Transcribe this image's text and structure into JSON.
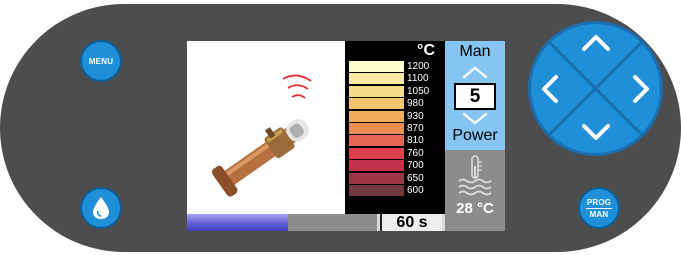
{
  "buttons": {
    "menu_label": "MENU",
    "prog_top": "PROG",
    "prog_bottom": "MAN"
  },
  "icons": {
    "menu_button": "menu-button",
    "water_drop": "water-drop-icon",
    "soldering_iron": "soldering-iron-icon",
    "thermometer": "thermometer-icon",
    "dpad_up": "chevron-up-icon",
    "dpad_down": "chevron-down-icon",
    "dpad_left": "chevron-left-icon",
    "dpad_right": "chevron-right-icon"
  },
  "colors": {
    "panel": "#4d4d4d",
    "accent_blue": "#1f8fd8",
    "mode_panel": "#86c5f1"
  },
  "display": {
    "scale": {
      "unit": "°C",
      "tiers": [
        {
          "label": "1200",
          "color": "#ffffcc"
        },
        {
          "label": "1100",
          "color": "#fbe9a6"
        },
        {
          "label": "1050",
          "color": "#f7dc8a"
        },
        {
          "label": "980",
          "color": "#f5c46f"
        },
        {
          "label": "930",
          "color": "#f1ab5b"
        },
        {
          "label": "870",
          "color": "#ec8e51"
        },
        {
          "label": "810",
          "color": "#e56650"
        },
        {
          "label": "760",
          "color": "#db3f4a"
        },
        {
          "label": "700",
          "color": "#c2334a"
        },
        {
          "label": "650",
          "color": "#9a3645"
        },
        {
          "label": "600",
          "color": "#733840"
        }
      ]
    },
    "timer": "60 s",
    "progress_fraction": 0.53,
    "mode": {
      "title": "Man",
      "value": "5",
      "subtitle": "Power"
    },
    "temperature": "28 °C"
  }
}
